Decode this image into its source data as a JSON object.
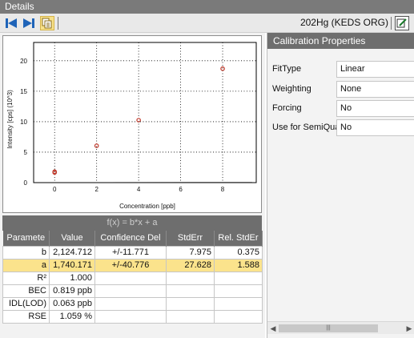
{
  "window": {
    "title": "Details"
  },
  "toolbar": {
    "title": "202Hg (KEDS ORG)",
    "buttons": [
      {
        "name": "first-icon"
      },
      {
        "name": "last-icon"
      },
      {
        "name": "copy-icon"
      }
    ],
    "right_icon": "edit-icon"
  },
  "chart_data": {
    "type": "scatter",
    "xlabel": "Concentration [ppb]",
    "ylabel": "Intensity [cps] (10^3)",
    "xlim": [
      -1.0,
      9.6
    ],
    "ylim": [
      0,
      23
    ],
    "x_ticks": [
      "0",
      "2",
      "4",
      "6",
      "8"
    ],
    "y_ticks": [
      "0",
      "5",
      "10",
      "15",
      "20"
    ],
    "grid": true,
    "points": [
      {
        "x": 0,
        "y": 1.8
      },
      {
        "x": 0,
        "y": 1.65
      },
      {
        "x": 2,
        "y": 6.05
      },
      {
        "x": 4,
        "y": 10.25
      },
      {
        "x": 8,
        "y": 18.7
      }
    ],
    "fit_line": {
      "slope": 2.124712,
      "intercept": 1.740171,
      "x_range": [
        -0.8,
        9.4
      ]
    },
    "colors": {
      "point": "#c0392b",
      "line": "#000000",
      "grid": "#000000"
    }
  },
  "fit": {
    "equation": "f(x) = b*x + a",
    "columns": [
      "Paramete",
      "Value",
      "Confidence Del",
      "StdErr",
      "Rel. StdEr"
    ],
    "rows": [
      [
        "b",
        "2,124.712",
        "+/-11.771",
        "7.975",
        "0.375"
      ],
      [
        "a",
        "1,740.171",
        "+/-40.776",
        "27.628",
        "1.588"
      ],
      [
        "R²",
        "1.000",
        "",
        "",
        ""
      ],
      [
        "BEC",
        "0.819 ppb",
        "",
        "",
        ""
      ],
      [
        "IDL(LOD)",
        "0.063 ppb",
        "",
        "",
        ""
      ],
      [
        "RSE",
        "1.059 %",
        "",
        "",
        ""
      ]
    ],
    "selected_row": 1,
    "colors": {
      "selected": "#fbe38c",
      "header": "#6e6e6e"
    }
  },
  "properties": {
    "header": "Calibration Properties",
    "items": [
      {
        "label": "FitType",
        "value": "Linear"
      },
      {
        "label": "Weighting",
        "value": "None"
      },
      {
        "label": "Forcing",
        "value": "No"
      },
      {
        "label": "Use for SemiQua",
        "value": "No"
      }
    ]
  },
  "scrollbar": {
    "thumb_grip": "|||"
  }
}
